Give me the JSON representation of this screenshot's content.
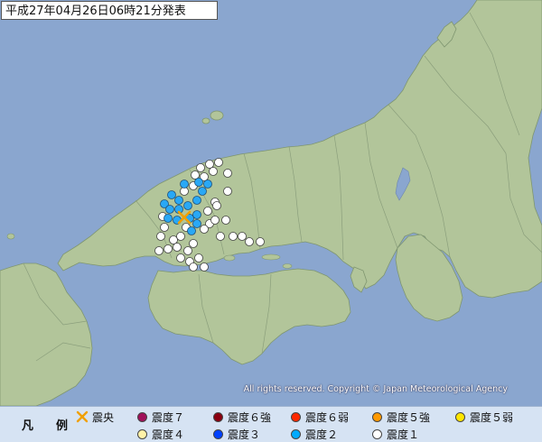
{
  "header": {
    "title": "平成27年04月26日06時21分発表"
  },
  "copyright": "All rights reserved. Copyright © Japan Meteorological Agency",
  "legend": {
    "label": "凡　例",
    "items": [
      {
        "label": "震央",
        "symbol": "cross",
        "color": "#f0a000"
      },
      {
        "label": "震度７",
        "symbol": "circle",
        "color": "#a0105a"
      },
      {
        "label": "震度６強",
        "symbol": "circle",
        "color": "#8a0010"
      },
      {
        "label": "震度６弱",
        "symbol": "circle",
        "color": "#ff2800"
      },
      {
        "label": "震度５強",
        "symbol": "circle",
        "color": "#ff9900"
      },
      {
        "label": "震度５弱",
        "symbol": "circle",
        "color": "#ffe600"
      },
      {
        "label": "震度４",
        "symbol": "circle",
        "color": "#fff2a8"
      },
      {
        "label": "震度３",
        "symbol": "circle",
        "color": "#0041ff"
      },
      {
        "label": "震度２",
        "symbol": "circle",
        "color": "#00aaff"
      },
      {
        "label": "震度１",
        "symbol": "circle",
        "color": "#ffffff"
      }
    ]
  },
  "colors": {
    "sea": "#8aa6cf",
    "land": "#b2c59a",
    "lake": "#8aa6cf",
    "intensity2": "#29a8f5",
    "intensity1": "#ffffff",
    "epicenter": "#f0a000"
  }
}
